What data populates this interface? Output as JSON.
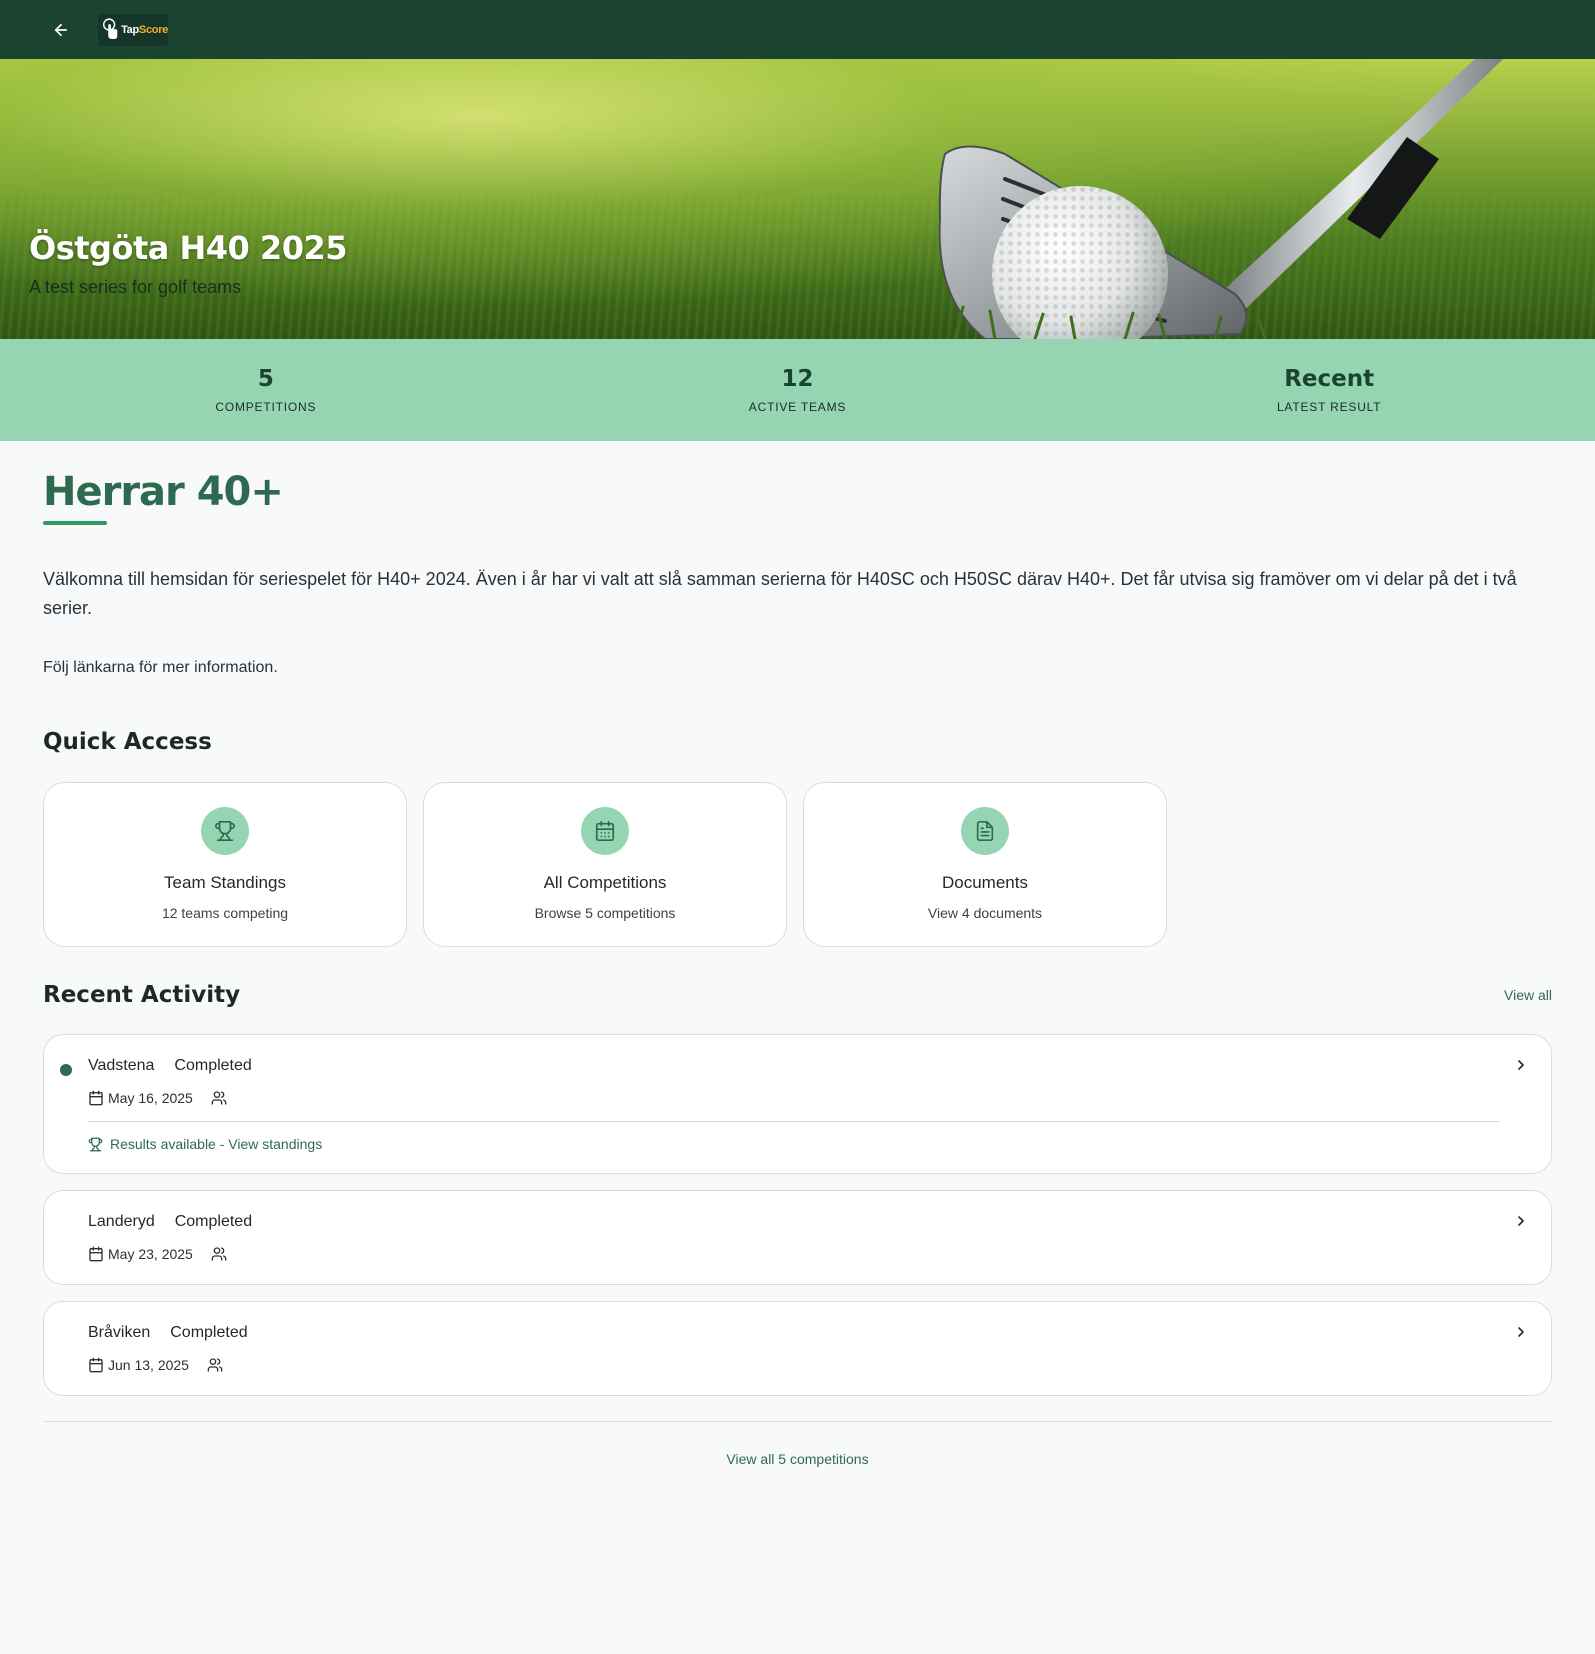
{
  "topbar": {
    "back_icon": "arrow-left-icon",
    "logo_tap": "Tap",
    "logo_score": "Score"
  },
  "hero": {
    "title": "Östgöta H40 2025",
    "subtitle": "A test series for golf teams"
  },
  "stats": [
    {
      "value": "5",
      "label": "COMPETITIONS"
    },
    {
      "value": "12",
      "label": "ACTIVE TEAMS"
    },
    {
      "value": "Recent",
      "label": "LATEST RESULT"
    }
  ],
  "main": {
    "title": "Herrar 40+",
    "intro": "Välkomna till hemsidan för seriespelet för H40+ 2024. Även i år har vi valt att slå samman serierna för H40SC och H50SC därav H40+. Det får utvisa sig framöver om vi delar på det i två serier.",
    "intro2": "Följ länkarna för mer information."
  },
  "quick_access": {
    "title": "Quick Access",
    "cards": [
      {
        "icon": "trophy-icon",
        "name": "Team Standings",
        "sub": "12 teams competing"
      },
      {
        "icon": "calendar-icon",
        "name": "All Competitions",
        "sub": "Browse 5 competitions"
      },
      {
        "icon": "document-icon",
        "name": "Documents",
        "sub": "View 4 documents"
      }
    ]
  },
  "recent_activity": {
    "title": "Recent Activity",
    "view_all": "View all",
    "items": [
      {
        "name": "Vadstena",
        "status": "Completed",
        "date": "May 16, 2025",
        "result": "Results available - View standings"
      },
      {
        "name": "Landeryd",
        "status": "Completed",
        "date": "May 23, 2025"
      },
      {
        "name": "Bråviken",
        "status": "Completed",
        "date": "Jun 13, 2025"
      }
    ],
    "view_all_competitions": "View all 5 competitions"
  },
  "colors": {
    "topbar": "#1b4332",
    "stats_band": "#95d5b2",
    "accent": "#2d6a4f"
  }
}
